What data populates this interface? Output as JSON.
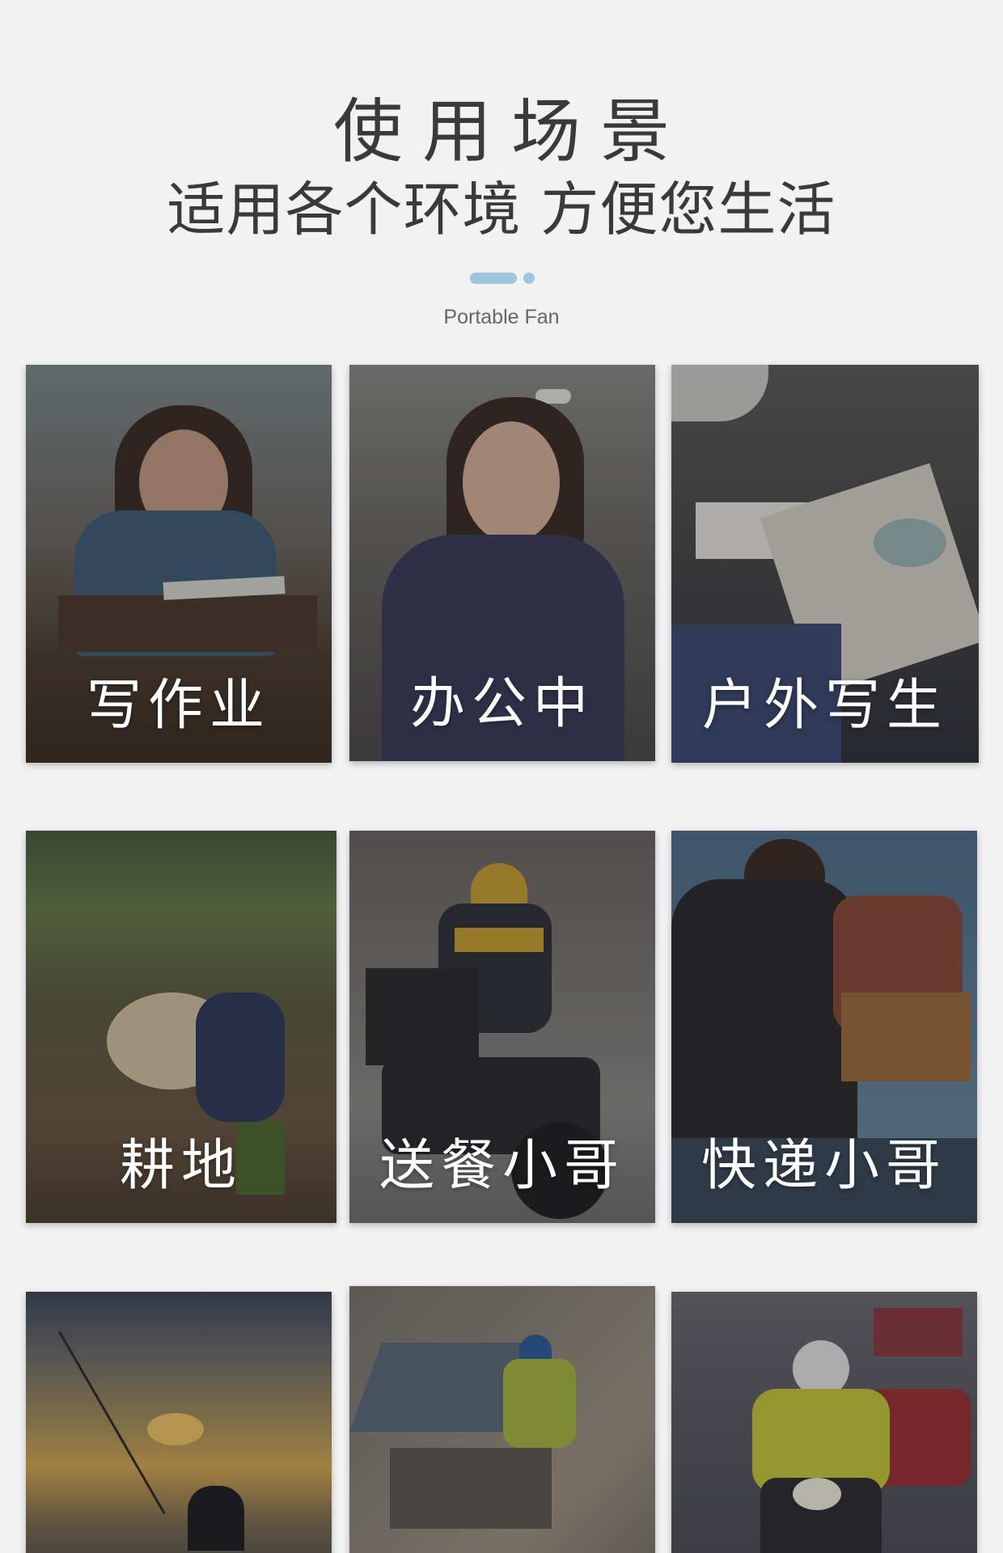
{
  "header": {
    "title": "使用场景",
    "subtitle": "适用各个环境 方便您生活",
    "tagline": "Portable Fan",
    "accent_color": "#9cc7de"
  },
  "scenes": [
    {
      "label": "写作业"
    },
    {
      "label": "办公中"
    },
    {
      "label": "户外写生"
    },
    {
      "label": "耕地"
    },
    {
      "label": "送餐小哥"
    },
    {
      "label": "快递小哥"
    },
    {
      "label": ""
    },
    {
      "label": ""
    },
    {
      "label": ""
    }
  ]
}
